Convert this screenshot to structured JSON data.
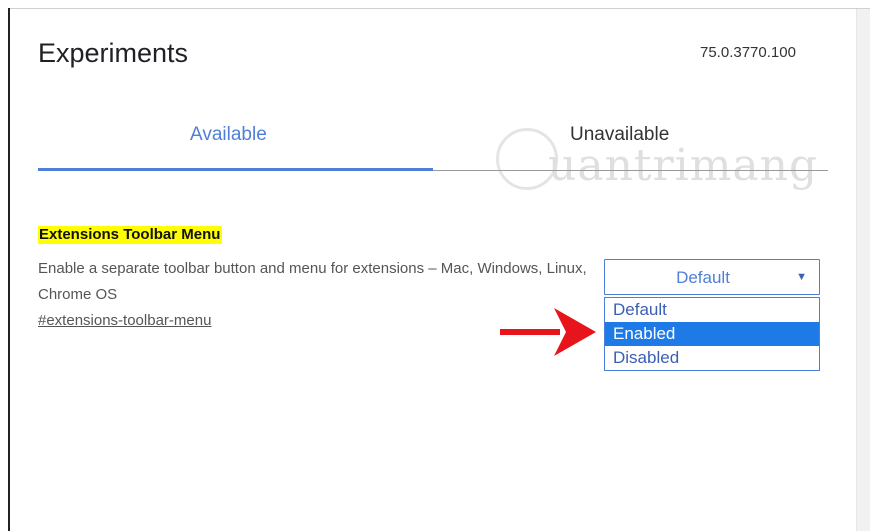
{
  "header": {
    "title": "Experiments",
    "version": "75.0.3770.100"
  },
  "tabs": [
    {
      "label": "Available",
      "active": true
    },
    {
      "label": "Unavailable",
      "active": false
    }
  ],
  "watermark": {
    "text": "uantrimang"
  },
  "flag": {
    "title": "Extensions Toolbar Menu",
    "description": "Enable a separate toolbar button and menu for extensions – Mac, Windows, Linux, Chrome OS",
    "link": "#extensions-toolbar-menu",
    "select": {
      "value": "Default",
      "options": [
        "Default",
        "Enabled",
        "Disabled"
      ],
      "highlighted": "Enabled"
    }
  },
  "colors": {
    "accent": "#4f7fd8",
    "highlight": "#ffff00",
    "option_selected": "#1e7ae6",
    "annotation_arrow": "#e8141c"
  },
  "icons": {
    "dropdown_chevron": "chevron-down-icon",
    "annotation": "red-arrow-icon"
  }
}
